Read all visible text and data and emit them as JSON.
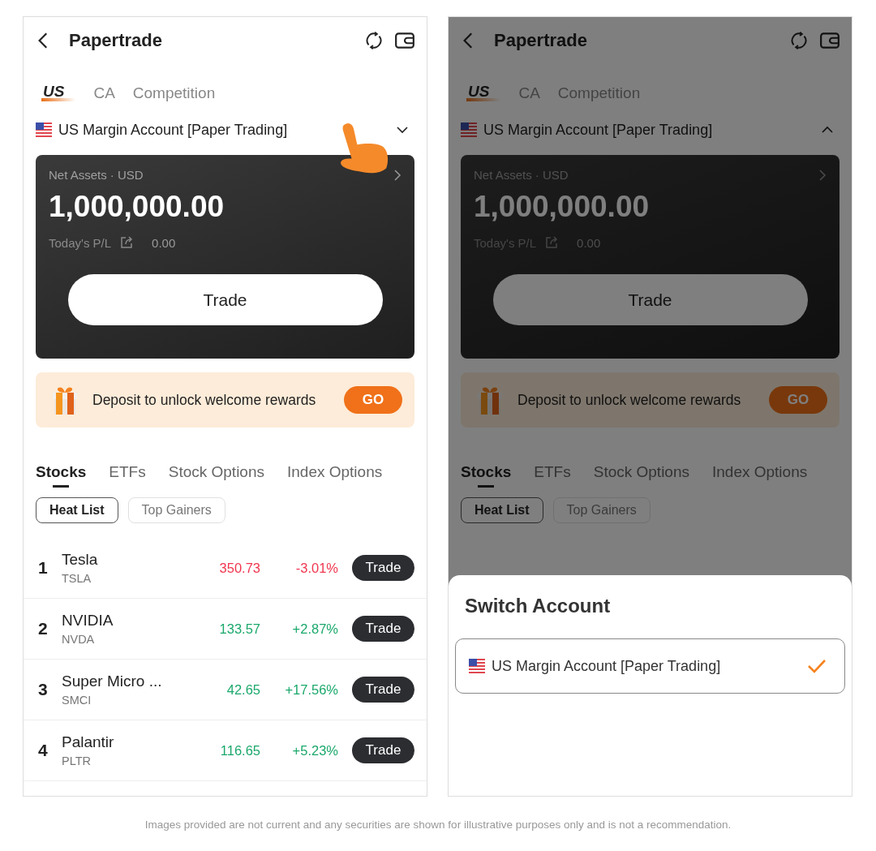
{
  "screens": [
    {
      "title": "Papertrade",
      "market_tabs": [
        {
          "label": "US",
          "selected": true
        },
        {
          "label": "CA",
          "selected": false
        },
        {
          "label": "Competition",
          "selected": false
        }
      ],
      "account": {
        "name": "US Margin Account [Paper Trading]",
        "expanded": false
      },
      "pointer_hint": true,
      "assets": {
        "label": "Net Assets · USD",
        "value": "1,000,000.00",
        "pl_label": "Today's P/L",
        "pl_value": "0.00"
      },
      "trade_button": "Trade",
      "promo": {
        "text": "Deposit to unlock welcome rewards",
        "button": "GO"
      },
      "asset_tabs": [
        {
          "label": "Stocks",
          "selected": true
        },
        {
          "label": "ETFs",
          "selected": false
        },
        {
          "label": "Stock Options",
          "selected": false
        },
        {
          "label": "Index Options",
          "selected": false
        }
      ],
      "filters": [
        {
          "label": "Heat List",
          "selected": true
        },
        {
          "label": "Top Gainers",
          "selected": false
        }
      ],
      "stocks": [
        {
          "rank": "1",
          "name": "Tesla",
          "symbol": "TSLA",
          "price": "350.73",
          "change": "-3.01%",
          "color": "#f0364f",
          "button": "Trade"
        },
        {
          "rank": "2",
          "name": "NVIDIA",
          "symbol": "NVDA",
          "price": "133.57",
          "change": "+2.87%",
          "color": "#1aa86b",
          "button": "Trade"
        },
        {
          "rank": "3",
          "name": "Super Micro ...",
          "symbol": "SMCI",
          "price": "42.65",
          "change": "+17.56%",
          "color": "#1aa86b",
          "button": "Trade"
        },
        {
          "rank": "4",
          "name": "Palantir",
          "symbol": "PLTR",
          "price": "116.65",
          "change": "+5.23%",
          "color": "#1aa86b",
          "button": "Trade"
        }
      ]
    },
    {
      "title": "Papertrade",
      "market_tabs": [
        {
          "label": "US",
          "selected": true
        },
        {
          "label": "CA",
          "selected": false
        },
        {
          "label": "Competition",
          "selected": false
        }
      ],
      "account": {
        "name": "US Margin Account [Paper Trading]",
        "expanded": true
      },
      "assets": {
        "label": "Net Assets · USD",
        "value": "1,000,000.00",
        "pl_label": "Today's P/L",
        "pl_value": "0.00"
      },
      "trade_button": "Trade",
      "promo": {
        "text": "Deposit to unlock welcome rewards",
        "button": "GO"
      },
      "asset_tabs": [
        {
          "label": "Stocks",
          "selected": true
        },
        {
          "label": "ETFs",
          "selected": false
        },
        {
          "label": "Stock Options",
          "selected": false
        },
        {
          "label": "Index Options",
          "selected": false
        }
      ],
      "filters": [
        {
          "label": "Heat List",
          "selected": true
        },
        {
          "label": "Top Gainers",
          "selected": false
        }
      ],
      "dimmed": true,
      "sheet": {
        "title": "Switch Account",
        "options": [
          {
            "label": "US Margin Account [Paper Trading]",
            "selected": true
          }
        ]
      }
    }
  ],
  "disclaimer": "Images provided are not current and any securities are shown for illustrative purposes only and is not a recommendation."
}
